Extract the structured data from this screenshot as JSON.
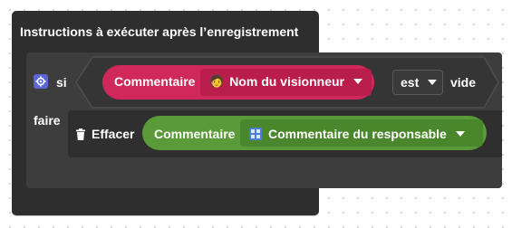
{
  "outer": {
    "title": "Instructions à exécuter après l’enregistrement"
  },
  "if_block": {
    "if_label": "si",
    "do_label": "faire",
    "compare_op": "est",
    "compare_value": "vide"
  },
  "condition": {
    "block_label": "Commentaire",
    "field_emoji": "🧑",
    "field_label": "Nom du visionneur",
    "color": "#d0285a"
  },
  "action": {
    "label": "Effacer",
    "icon": "trash-icon",
    "block_label": "Commentaire",
    "field_icon": "text-field-icon",
    "field_label": "Commentaire du responsable",
    "color": "#5a9a38"
  }
}
